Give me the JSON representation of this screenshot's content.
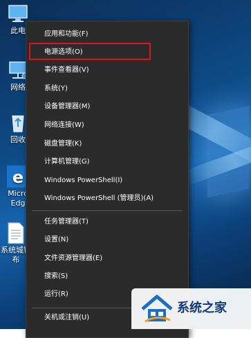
{
  "desktop": {
    "icons": [
      {
        "label": "此电",
        "icon": "this-pc-icon"
      },
      {
        "label": "网络",
        "icon": "network-icon"
      },
      {
        "label": "回收",
        "icon": "recycle-bin-icon"
      },
      {
        "label": "Micro",
        "label2": "Edg",
        "icon": "edge-icon"
      },
      {
        "label": "系统城镇",
        "label2": "布",
        "icon": "document-icon"
      }
    ]
  },
  "menu": {
    "items": [
      {
        "label": "应用和功能(F)"
      },
      {
        "label": "电源选项(O)"
      },
      {
        "label": "事件查看器(V)"
      },
      {
        "label": "系统(Y)"
      },
      {
        "label": "设备管理器(M)"
      },
      {
        "label": "网络连接(W)"
      },
      {
        "label": "磁盘管理(K)"
      },
      {
        "label": "计算机管理(G)"
      },
      {
        "label": "Windows PowerShell(I)"
      },
      {
        "label": "Windows PowerShell (管理员)(A)"
      },
      {
        "label": "任务管理器(T)"
      },
      {
        "label": "设置(N)"
      },
      {
        "label": "文件资源管理器(E)"
      },
      {
        "label": "搜索(S)"
      },
      {
        "label": "运行(R)"
      },
      {
        "label": "关机或注销(U)"
      }
    ],
    "highlighted": "电源选项(O)",
    "highlight_color": "#e0121e"
  },
  "watermark": {
    "text": "系统之家",
    "logo": "house-logo-icon"
  },
  "colors": {
    "menu_bg": "#2b2b2b",
    "menu_text": "#ffffff",
    "desktop_blue": "#1665b0"
  }
}
